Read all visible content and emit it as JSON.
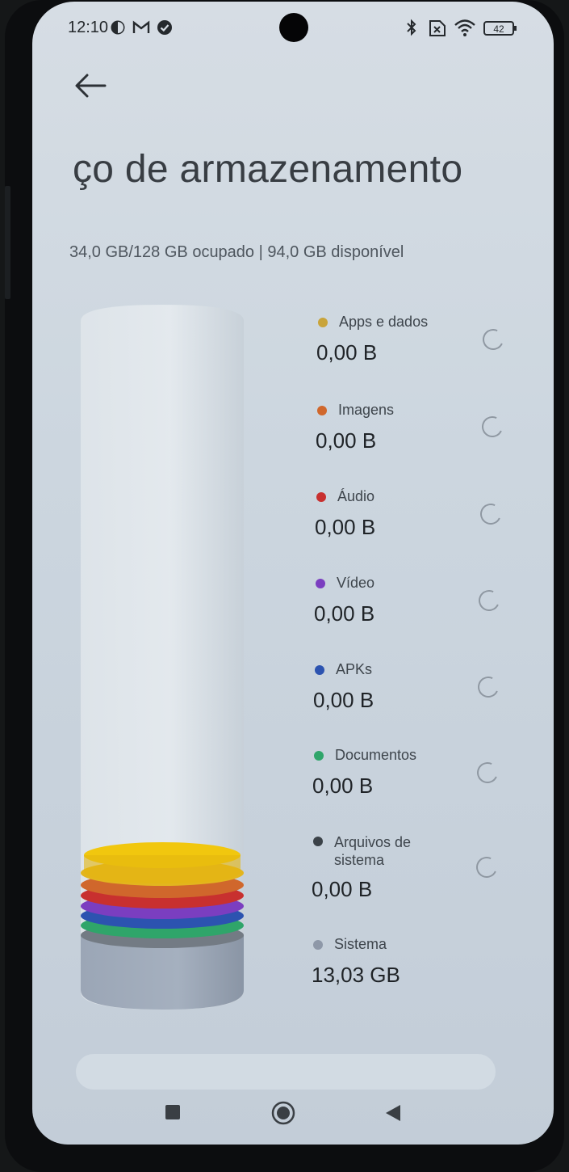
{
  "status_bar": {
    "time": "12:10",
    "battery": "42",
    "left_icons": [
      "contrast-icon",
      "gmail-icon",
      "check-badge-icon"
    ],
    "right_icons": [
      "bluetooth-icon",
      "no-sim-icon",
      "wifi-icon",
      "battery-icon"
    ]
  },
  "header": {
    "back_icon": "back-arrow-icon",
    "title": "ço de armazenamento"
  },
  "summary": "34,0 GB/128 GB ocupado | 94,0 GB disponível",
  "categories": [
    {
      "label": "Apps e dados",
      "value": "0,00 B",
      "color": "#c9a43a",
      "loading": true
    },
    {
      "label": "Imagens",
      "value": "0,00 B",
      "color": "#d0672c",
      "loading": true
    },
    {
      "label": "Áudio",
      "value": "0,00 B",
      "color": "#c8302f",
      "loading": true
    },
    {
      "label": "Vídeo",
      "value": "0,00 B",
      "color": "#7b3ec0",
      "loading": true
    },
    {
      "label": "APKs",
      "value": "0,00 B",
      "color": "#2c53b0",
      "loading": true
    },
    {
      "label": "Documentos",
      "value": "0,00 B",
      "color": "#2fa56a",
      "loading": true
    },
    {
      "label": "Arquivos de sistema",
      "value": "0,00 B",
      "color": "#3b4248",
      "loading": true
    },
    {
      "label": "Sistema",
      "value": "13,03 GB",
      "color": "#8e98a8",
      "loading": false
    }
  ],
  "nav_bar": {
    "recents_icon": "recents-square-icon",
    "home_icon": "home-circle-icon",
    "back_icon": "back-triangle-icon"
  }
}
